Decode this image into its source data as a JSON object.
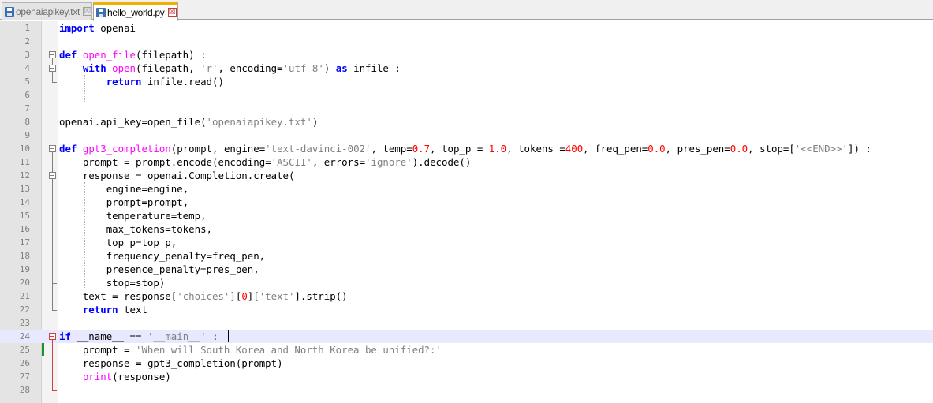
{
  "tabs": [
    {
      "label": "openaiapikey.txt",
      "active": false,
      "close": "☒"
    },
    {
      "label": "hello_world.py",
      "active": true,
      "close": "☒"
    }
  ],
  "icons": {
    "file": "floppy-disk-icon",
    "close": "close-tab-icon",
    "fold": "fold-minus-icon"
  },
  "colors": {
    "keyword": "#0000ff",
    "function": "#ff00ff",
    "string": "#808080",
    "number": "#ff0000",
    "current_line": "#e8e8ff"
  },
  "editor": {
    "current_line": 24,
    "lines": [
      {
        "n": "1",
        "t": "import openai"
      },
      {
        "n": "2",
        "t": ""
      },
      {
        "n": "3",
        "t": "def open_file(filepath) :"
      },
      {
        "n": "4",
        "t": "    with open(filepath, 'r', encoding='utf-8') as infile :"
      },
      {
        "n": "5",
        "t": "        return infile.read()"
      },
      {
        "n": "6",
        "t": ""
      },
      {
        "n": "7",
        "t": ""
      },
      {
        "n": "8",
        "t": "openai.api_key=open_file('openaiapikey.txt')"
      },
      {
        "n": "9",
        "t": ""
      },
      {
        "n": "10",
        "t": "def gpt3_completion(prompt, engine='text-davinci-002', temp=0.7, top_p = 1.0, tokens =400, freq_pen=0.0, pres_pen=0.0, stop=['<<END>>']) :"
      },
      {
        "n": "11",
        "t": "    prompt = prompt.encode(encoding='ASCII', errors='ignore').decode()"
      },
      {
        "n": "12",
        "t": "    response = openai.Completion.create("
      },
      {
        "n": "13",
        "t": "        engine=engine,"
      },
      {
        "n": "14",
        "t": "        prompt=prompt,"
      },
      {
        "n": "15",
        "t": "        temperature=temp,"
      },
      {
        "n": "16",
        "t": "        max_tokens=tokens,"
      },
      {
        "n": "17",
        "t": "        top_p=top_p,"
      },
      {
        "n": "18",
        "t": "        frequency_penalty=freq_pen,"
      },
      {
        "n": "19",
        "t": "        presence_penalty=pres_pen,"
      },
      {
        "n": "20",
        "t": "        stop=stop)"
      },
      {
        "n": "21",
        "t": "    text = response['choices'][0]['text'].strip()"
      },
      {
        "n": "22",
        "t": "    return text"
      },
      {
        "n": "23",
        "t": ""
      },
      {
        "n": "24",
        "t": "if __name__ == '__main__' :"
      },
      {
        "n": "25",
        "t": "    prompt = 'When will South Korea and North Korea be unified?:'"
      },
      {
        "n": "26",
        "t": "    response = gpt3_completion(prompt)"
      },
      {
        "n": "27",
        "t": "    print(response)"
      },
      {
        "n": "28",
        "t": ""
      }
    ]
  }
}
